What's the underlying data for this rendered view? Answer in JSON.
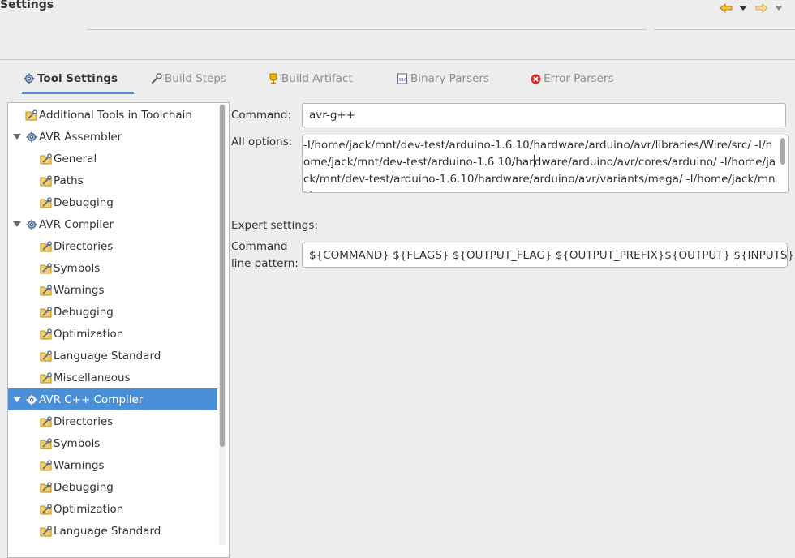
{
  "window": {
    "title": "Settings"
  },
  "nav": {
    "back_icon": "arrow-left-icon",
    "forward_icon": "arrow-right-icon",
    "dropdown_icon": "chevron-down-icon"
  },
  "tabs": [
    {
      "label": "Tool Settings",
      "icon": "gear-icon",
      "active": true
    },
    {
      "label": "Build Steps",
      "icon": "wrench-icon",
      "active": false
    },
    {
      "label": "Build Artifact",
      "icon": "trophy-icon",
      "active": false
    },
    {
      "label": "Binary Parsers",
      "icon": "binary-file-icon",
      "active": false
    },
    {
      "label": "Error Parsers",
      "icon": "error-icon",
      "active": false
    }
  ],
  "tree": [
    {
      "label": "Additional Tools in Toolchain",
      "level": 0,
      "kind": "settings"
    },
    {
      "label": "AVR Assembler",
      "level": 0,
      "kind": "tool",
      "expanded": true
    },
    {
      "label": "General",
      "level": 1,
      "kind": "settings"
    },
    {
      "label": "Paths",
      "level": 1,
      "kind": "settings"
    },
    {
      "label": "Debugging",
      "level": 1,
      "kind": "settings"
    },
    {
      "label": "AVR Compiler",
      "level": 0,
      "kind": "tool",
      "expanded": true
    },
    {
      "label": "Directories",
      "level": 1,
      "kind": "settings"
    },
    {
      "label": "Symbols",
      "level": 1,
      "kind": "settings"
    },
    {
      "label": "Warnings",
      "level": 1,
      "kind": "settings"
    },
    {
      "label": "Debugging",
      "level": 1,
      "kind": "settings"
    },
    {
      "label": "Optimization",
      "level": 1,
      "kind": "settings"
    },
    {
      "label": "Language Standard",
      "level": 1,
      "kind": "settings"
    },
    {
      "label": "Miscellaneous",
      "level": 1,
      "kind": "settings"
    },
    {
      "label": "AVR C++ Compiler",
      "level": 0,
      "kind": "tool",
      "expanded": true,
      "selected": true
    },
    {
      "label": "Directories",
      "level": 1,
      "kind": "settings"
    },
    {
      "label": "Symbols",
      "level": 1,
      "kind": "settings"
    },
    {
      "label": "Warnings",
      "level": 1,
      "kind": "settings"
    },
    {
      "label": "Debugging",
      "level": 1,
      "kind": "settings"
    },
    {
      "label": "Optimization",
      "level": 1,
      "kind": "settings"
    },
    {
      "label": "Language Standard",
      "level": 1,
      "kind": "settings"
    }
  ],
  "form": {
    "command_label": "Command:",
    "command_value": "avr-g++",
    "all_options_label": "All options:",
    "all_options_before_caret": "-I/home/jack/mnt/dev-test/arduino-1.6.10/hardware/arduino/avr/libraries/Wire/src/ -I/home/jack/mnt/dev-test/arduino-1.6.10/har",
    "all_options_after_caret": "dware/arduino/avr/cores/arduino/ -I/home/jack/mnt/dev-test/arduino-1.6.10/hardware/arduino/avr/variants/mega/ -I/home/jack/mnt/",
    "expert_settings_label": "Expert settings:",
    "command_line_pattern_label_1": "Command",
    "command_line_pattern_label_2": "line pattern:",
    "command_line_pattern_value": "${COMMAND} ${FLAGS} ${OUTPUT_FLAG} ${OUTPUT_PREFIX}${OUTPUT} ${INPUTS}"
  },
  "colors": {
    "selection": "#4a90d9",
    "background": "#ededed",
    "nav_arrow": "#e8a317"
  }
}
